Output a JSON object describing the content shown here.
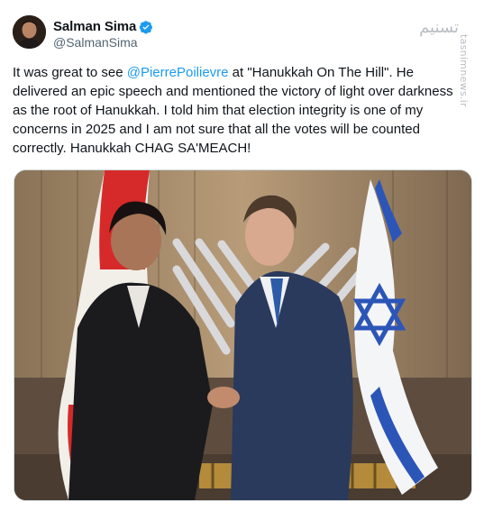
{
  "author": {
    "display_name": "Salman Sima",
    "handle": "@SalmanSima",
    "verified": true,
    "accent_color": "#1d9bf0"
  },
  "watermark": {
    "text": "tasnimnews.ir",
    "logo_glyph": "تسنیم"
  },
  "tweet": {
    "part1": "It was great to see ",
    "mention": "@PierrePoilievre",
    "part2": " at \"Hanukkah On The Hill\". He delivered an epic speech and mentioned the victory of light over darkness as the root of Hanukkah. I told him that election integrity is one of my concerns in 2025 and I am not sure that all the votes will be counted correctly. Hanukkah CHAG SA'MEACH!"
  },
  "media": {
    "alt": "photo"
  }
}
